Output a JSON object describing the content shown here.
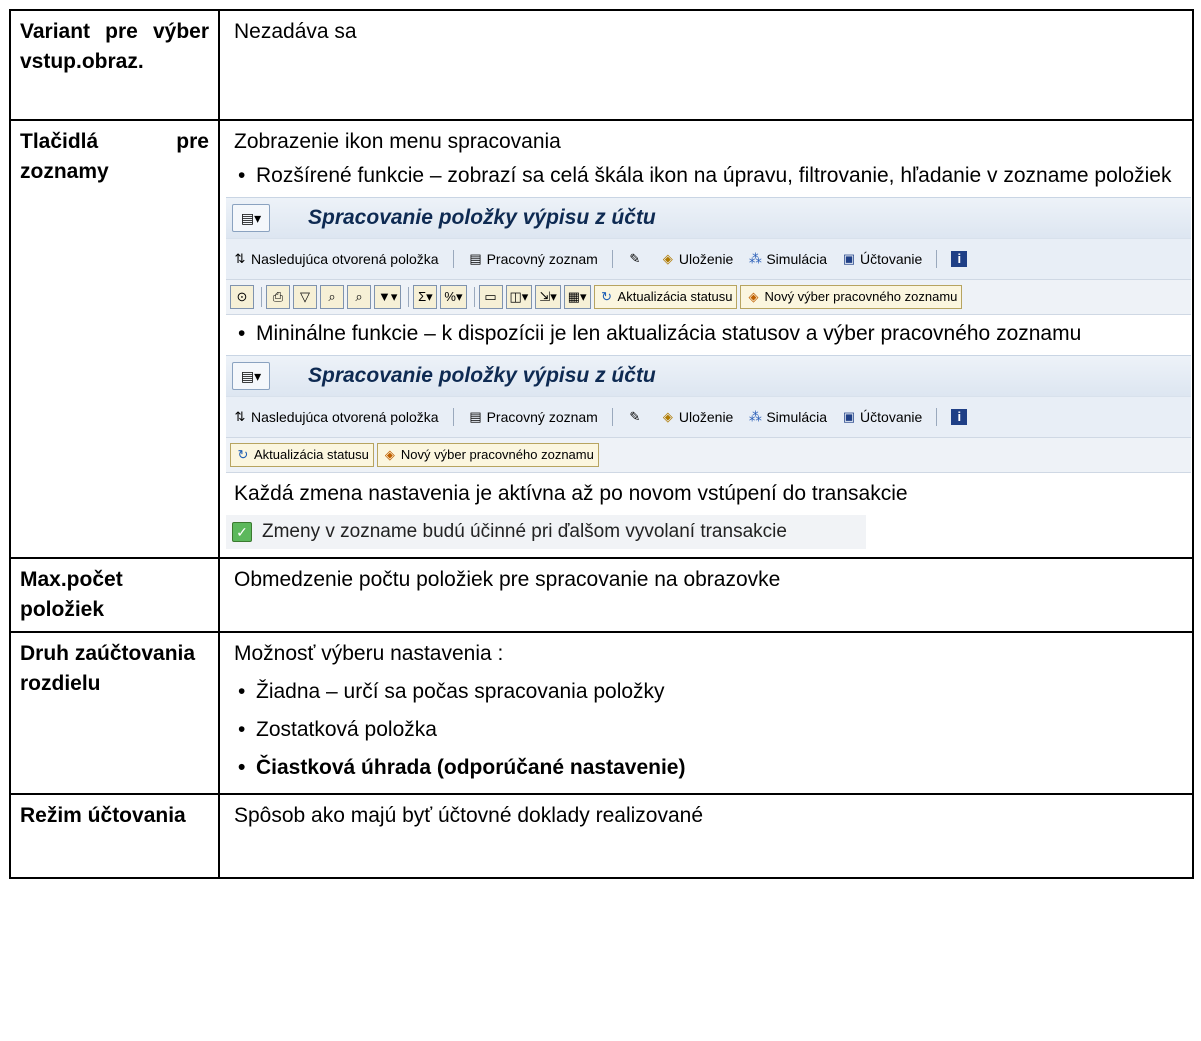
{
  "rows": [
    {
      "label": "Variant pre výber vstup.obraz.",
      "text": "Nezadáva sa"
    },
    {
      "label": "Tlačidlá pre zoznamy",
      "intro": "Zobrazenie ikon menu spracovania",
      "bullet1": "Rozšírené funkcie – zobrazí sa celá škála ikon na úpravu, filtrovanie, hľadanie v zozname položiek",
      "bullet2": "Mininálne funkcie – k dispozícii je len aktualizácia statusov a výber pracovného zoznamu",
      "note": "Každá zmena nastavenia je aktívna až po novom vstúpení do transakcie",
      "checkbox_label": "Zmeny v zozname budú účinné pri ďalšom vyvolaní transakcie"
    },
    {
      "label": "Max.počet položiek",
      "text": "Obmedzenie počtu položiek pre spracovanie na obrazovke"
    },
    {
      "label": "Druh zaúčtovania rozdielu",
      "intro": "Možnosť výberu nastavenia :",
      "options": [
        "Žiadna – určí sa počas spracovania položky",
        "Zostatková položka",
        "Čiastková úhrada (odporúčané nastavenie)"
      ]
    },
    {
      "label": "Režim účtovania",
      "text": "Spôsob ako majú byť účtovné doklady realizované"
    }
  ],
  "sap": {
    "title": "Spracovanie položky výpisu z účtu",
    "next_item": "Nasledujúca otvorená položka",
    "worklist": "Pracovný zoznam",
    "save": "Uloženie",
    "simulate": "Simulácia",
    "post": "Účtovanie",
    "status_update": "Aktualizácia statusu",
    "new_selection": "Nový výber pracovného zoznamu"
  }
}
